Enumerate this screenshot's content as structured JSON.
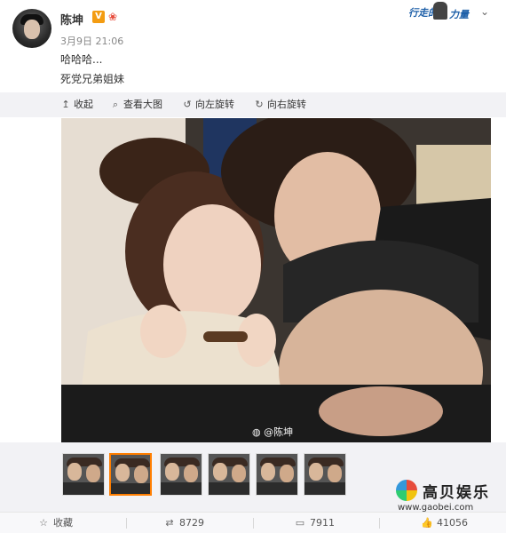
{
  "post": {
    "author": "陈坤",
    "verified_badge": "V",
    "time": "3月9日 21:06",
    "text_line1": "哈哈哈...",
    "text_line2": "死党兄弟姐妹"
  },
  "brand_tag": {
    "text1": "行走的",
    "text2": "力量"
  },
  "toolbar": {
    "collapse": "收起",
    "view_large": "查看大图",
    "rotate_left": "向左旋转",
    "rotate_right": "向右旋转"
  },
  "photo": {
    "watermark": "@陈坤"
  },
  "thumbnails": {
    "count": 6,
    "active_index": 1
  },
  "site_logo": {
    "title": "高贝娱乐",
    "url": "www.gaobei.com"
  },
  "actions": {
    "favorite": "收藏",
    "repost_count": "8729",
    "comment_count": "7911",
    "like_count": "41056"
  },
  "icons": {
    "collapse": "arrow-up-icon",
    "view_large": "magnifier-icon",
    "rotate_left": "rotate-left-icon",
    "rotate_right": "rotate-right-icon",
    "favorite": "star-icon",
    "repost": "repost-icon",
    "comment": "comment-icon",
    "like": "thumbs-up-icon",
    "menu": "chevron-down-icon"
  }
}
